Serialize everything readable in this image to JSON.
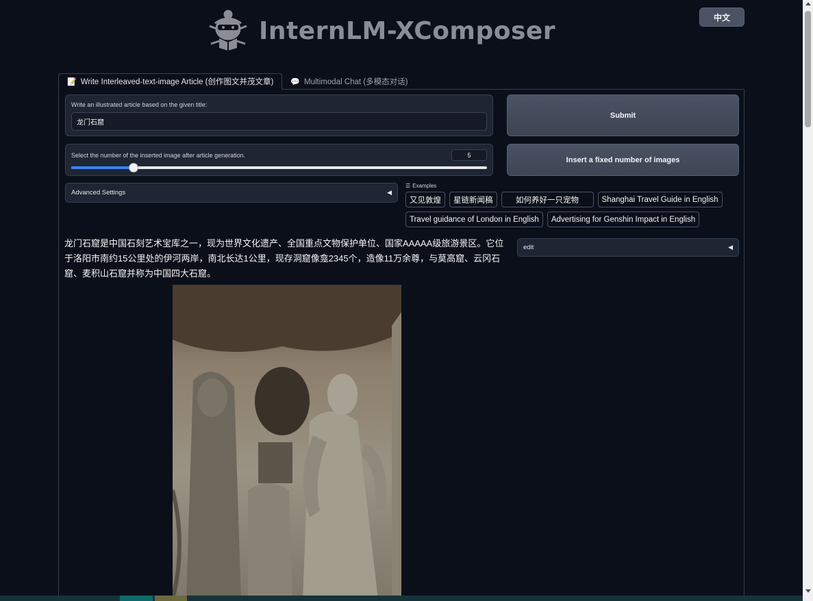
{
  "header": {
    "app_title": "InternLM-XComposer",
    "logo_icon": "scholar-mascot-icon"
  },
  "lang_button": "中文",
  "tabs": [
    {
      "label": "Write Interleaved-text-image Article (创作图文并茂文章)",
      "icon": "memo-icon",
      "active": true
    },
    {
      "label": "Multimodal Chat (多模态对话)",
      "icon": "speech-bubble-icon",
      "active": false
    }
  ],
  "title_input": {
    "label": "Write an illustrated article based on the given title:",
    "value": "龙门石窟"
  },
  "image_count": {
    "label": "Select the number of the inserted image after article generation.",
    "value": "5",
    "fraction": 0.15
  },
  "buttons": {
    "submit": "Submit",
    "insert": "Insert a fixed number of images"
  },
  "advanced_settings": "Advanced Settings",
  "examples": {
    "label": "Examples",
    "items": [
      "又见敦煌",
      "星链新闻稿",
      "如何养好一只宠物",
      "Shanghai Travel Guide in English",
      "Travel guidance of London in English",
      "Advertising for Genshin Impact in English"
    ]
  },
  "edit_accordion": "edit",
  "article": {
    "paragraph": "龙门石窟是中国石刻艺术宝库之一，现为世界文化遗产、全国重点文物保护单位、国家AAAAA级旅游景区。它位于洛阳市南约15公里处的伊河两岸，南北长达1公里，现存洞窟像龛2345个，造像11万余尊，与莫高窟、云冈石窟、麦积山石窟并称为中国四大石窟。"
  },
  "colors": {
    "background": "#0b0f19",
    "block": "#1f2533",
    "accent": "#3b82f6"
  }
}
